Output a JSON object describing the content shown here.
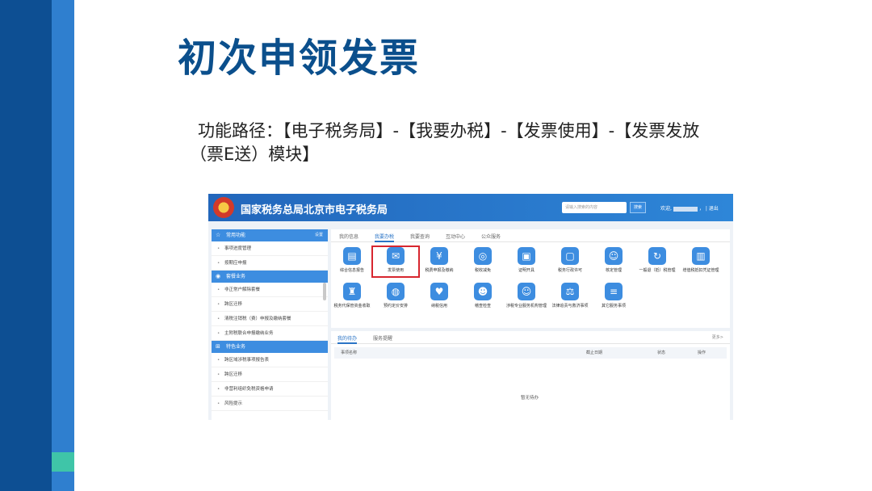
{
  "slide": {
    "title": "初次申领发票",
    "path_line1": "功能路径：【电子税务局】-【我要办税】-【发票使用】-【发票发放",
    "path_line2": "（票E送）模块】"
  },
  "colors": {
    "brand_dark": "#0d4f93",
    "brand_light": "#2f7fcf",
    "accent": "#3fc5a8",
    "highlight": "#d7262f"
  },
  "app": {
    "site_title": "国家税务总局北京市电子税务局",
    "search_placeholder": "请输入搜索的内容",
    "search_button": "搜索",
    "welcome": "欢迎,",
    "welcome_suffix": "，",
    "logout": "| 退出"
  },
  "sidebar": {
    "sections": [
      {
        "title": "常用功能",
        "extra": "设置",
        "icon": "star-icon",
        "items": [
          "事项进度管理",
          "按期应申报"
        ]
      },
      {
        "title": "套餐业务",
        "icon": "package-icon",
        "items": [
          "非正常户解除套餐",
          "跨区迁移",
          "清税注销税（费）申报及缴纳套餐",
          "主附税联合申报缴纳业务"
        ]
      },
      {
        "title": "特色业务",
        "icon": "grid-icon",
        "items": [
          "跨区域涉税事项报告表",
          "跨区迁移",
          "非营利组织免税资格申请",
          "风险提示"
        ]
      }
    ]
  },
  "main": {
    "tabs": [
      "我的信息",
      "我要办税",
      "我要查询",
      "互动中心",
      "公众服务"
    ],
    "functions": [
      {
        "label": "综合信息报告",
        "icon": "document-icon",
        "glyph": "▤"
      },
      {
        "label": "发票使用",
        "icon": "invoice-icon",
        "glyph": "✉"
      },
      {
        "label": "税费申报及缴纳",
        "icon": "tax-payment-icon",
        "glyph": "¥"
      },
      {
        "label": "税收减免",
        "icon": "tax-relief-icon",
        "glyph": "◎"
      },
      {
        "label": "证明开具",
        "icon": "certificate-icon",
        "glyph": "▣"
      },
      {
        "label": "税务行政许可",
        "icon": "permit-icon",
        "glyph": "▢"
      },
      {
        "label": "核定管理",
        "icon": "verify-icon",
        "glyph": "☺"
      },
      {
        "label": "一般退（抵）税管理",
        "icon": "refund-icon",
        "glyph": "↻"
      },
      {
        "label": "增值税抵扣凭证管理",
        "icon": "voucher-icon",
        "glyph": "▥"
      },
      {
        "label": "税务代保管资金收取",
        "icon": "fund-icon",
        "glyph": "♜"
      },
      {
        "label": "预约定价安排",
        "icon": "pricing-icon",
        "glyph": "◍"
      },
      {
        "label": "纳税信用",
        "icon": "credit-icon",
        "glyph": "♥"
      },
      {
        "label": "稽查检查",
        "icon": "inspection-icon",
        "glyph": "☻"
      },
      {
        "label": "涉税专业服务机构管理",
        "icon": "agency-icon",
        "glyph": "☺"
      },
      {
        "label": "法律追责与救济事项",
        "icon": "law-icon",
        "glyph": "⚖"
      },
      {
        "label": "其它服务事项",
        "icon": "other-services-icon",
        "glyph": "≡"
      }
    ]
  },
  "todo": {
    "tabs": [
      "我的待办",
      "服务提醒"
    ],
    "more": "更多>",
    "columns": [
      "事项名称",
      "截止日期",
      "状态",
      "操作"
    ],
    "empty": "暂无待办"
  }
}
